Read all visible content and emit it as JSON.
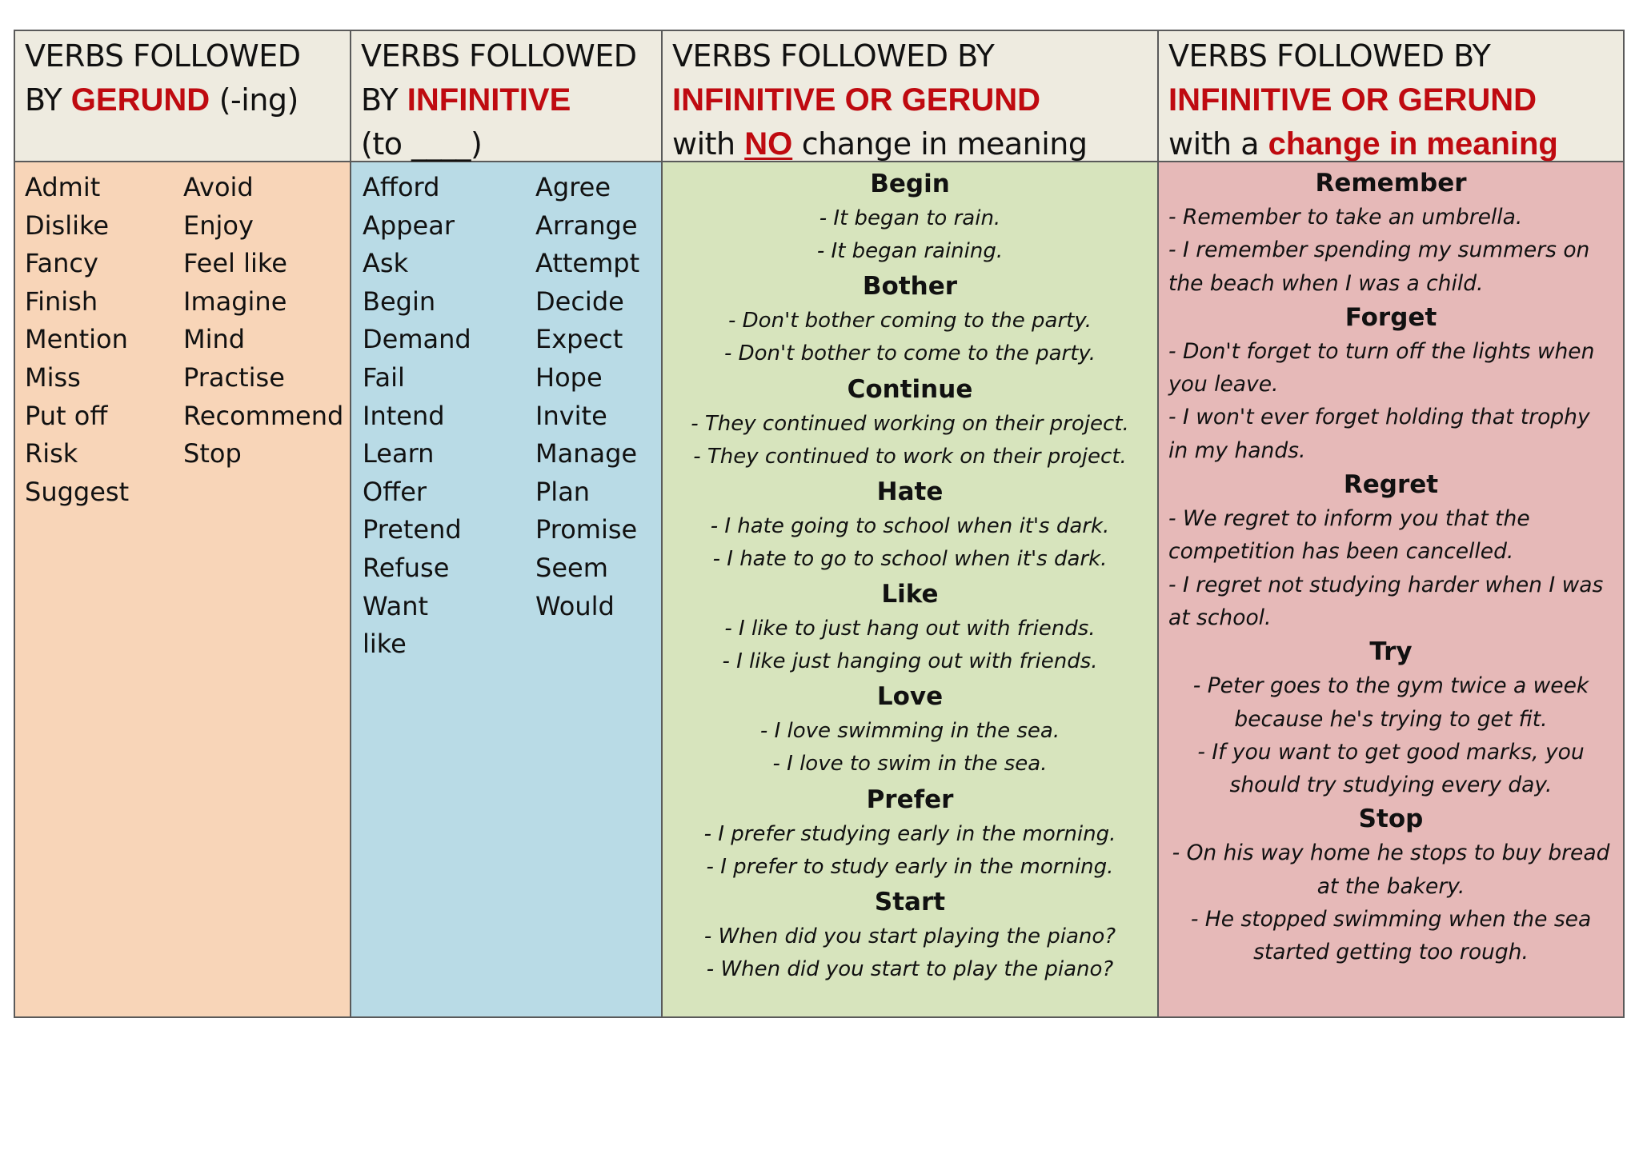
{
  "columns": [
    {
      "header": {
        "line1": "VERBS FOLLOWED",
        "line2_prefix": "BY ",
        "line2_highlight": "GERUND",
        "line2_suffix": " (-ing)"
      },
      "words_left": [
        "Admit",
        "Dislike",
        "Fancy",
        "Finish",
        "Mention",
        "Miss",
        "Put off",
        "Risk",
        "Suggest"
      ],
      "words_right": [
        "Avoid",
        "Enjoy",
        "Feel like",
        "Imagine",
        "Mind",
        "Practise",
        "Recommend",
        "Stop"
      ]
    },
    {
      "header": {
        "line1": "VERBS FOLLOWED",
        "line2_prefix": "BY ",
        "line2_highlight": "INFINITIVE",
        "line3": "(to ____)"
      },
      "words_left": [
        "Afford",
        "Appear",
        "Ask",
        "Begin",
        "Demand",
        "Fail",
        "Intend",
        "Learn",
        "Offer",
        "Pretend",
        "Refuse",
        "Want",
        "like"
      ],
      "words_right": [
        "Agree",
        "Arrange",
        "Attempt",
        "Decide",
        "Expect",
        "Hope",
        "Invite",
        "Manage",
        "Plan",
        "Promise",
        "Seem",
        "Would"
      ]
    },
    {
      "header": {
        "line1": "VERBS FOLLOWED BY",
        "line2_highlight": "INFINITIVE OR GERUND",
        "line3_prefix": "with ",
        "line3_highlight": "NO",
        "line3_suffix": " change in meaning"
      },
      "groups": [
        {
          "verb": "Begin",
          "examples": [
            "- It began to rain.",
            "- It began raining."
          ]
        },
        {
          "verb": "Bother",
          "examples": [
            "- Don't bother coming to the party.",
            "- Don't bother to come to the party."
          ]
        },
        {
          "verb": "Continue",
          "examples": [
            "- They continued working on their project.",
            "- They continued to work on their project."
          ]
        },
        {
          "verb": "Hate",
          "examples": [
            "- I hate going to school when it's dark.",
            "- I hate to go to school when it's dark."
          ]
        },
        {
          "verb": "Like",
          "examples": [
            "- I like to just hang out with friends.",
            "- I like just hanging out with friends."
          ]
        },
        {
          "verb": "Love",
          "examples": [
            "- I love swimming in the sea.",
            "- I love to swim in the sea."
          ]
        },
        {
          "verb": "Prefer",
          "examples": [
            "- I prefer studying early in the morning.",
            "- I prefer to study early in the morning."
          ]
        },
        {
          "verb": "Start",
          "examples": [
            "- When did you start playing the piano?",
            "- When did you start to play the piano?"
          ]
        }
      ]
    },
    {
      "header": {
        "line1": "VERBS FOLLOWED BY",
        "line2_highlight": "INFINITIVE OR GERUND",
        "line3_prefix": "with a ",
        "line3_highlight": "change in meaning"
      },
      "groups": [
        {
          "verb": "Remember",
          "examples": [
            "- Remember to take an umbrella.",
            "- I remember spending my summers on the beach when I was a child."
          ]
        },
        {
          "verb": "Forget",
          "examples": [
            "- Don't forget to turn off the lights when you leave.",
            "- I won't ever forget holding that trophy in my hands."
          ]
        },
        {
          "verb": "Regret",
          "examples": [
            "- We regret to inform you that the competition has been cancelled.",
            "- I regret not studying harder when I was at school."
          ]
        },
        {
          "verb": "Try",
          "examples": [
            "- Peter goes to the gym twice a week because he's trying to get fit.",
            "- If you want to get good marks, you should try studying every day."
          ]
        },
        {
          "verb": "Stop",
          "examples": [
            "- On his way home he stops to buy bread at the bakery.",
            "- He stopped swimming when the sea started getting too rough."
          ]
        }
      ]
    }
  ],
  "colors": {
    "header_bg": "#eeebe0",
    "gerund_bg": "#f8d5b8",
    "infinitive_bg": "#b9dbe6",
    "no_change_bg": "#d7e4bd",
    "change_bg": "#e6b9b8",
    "highlight_red": "#bf0a10",
    "border": "#5a5a5a"
  }
}
